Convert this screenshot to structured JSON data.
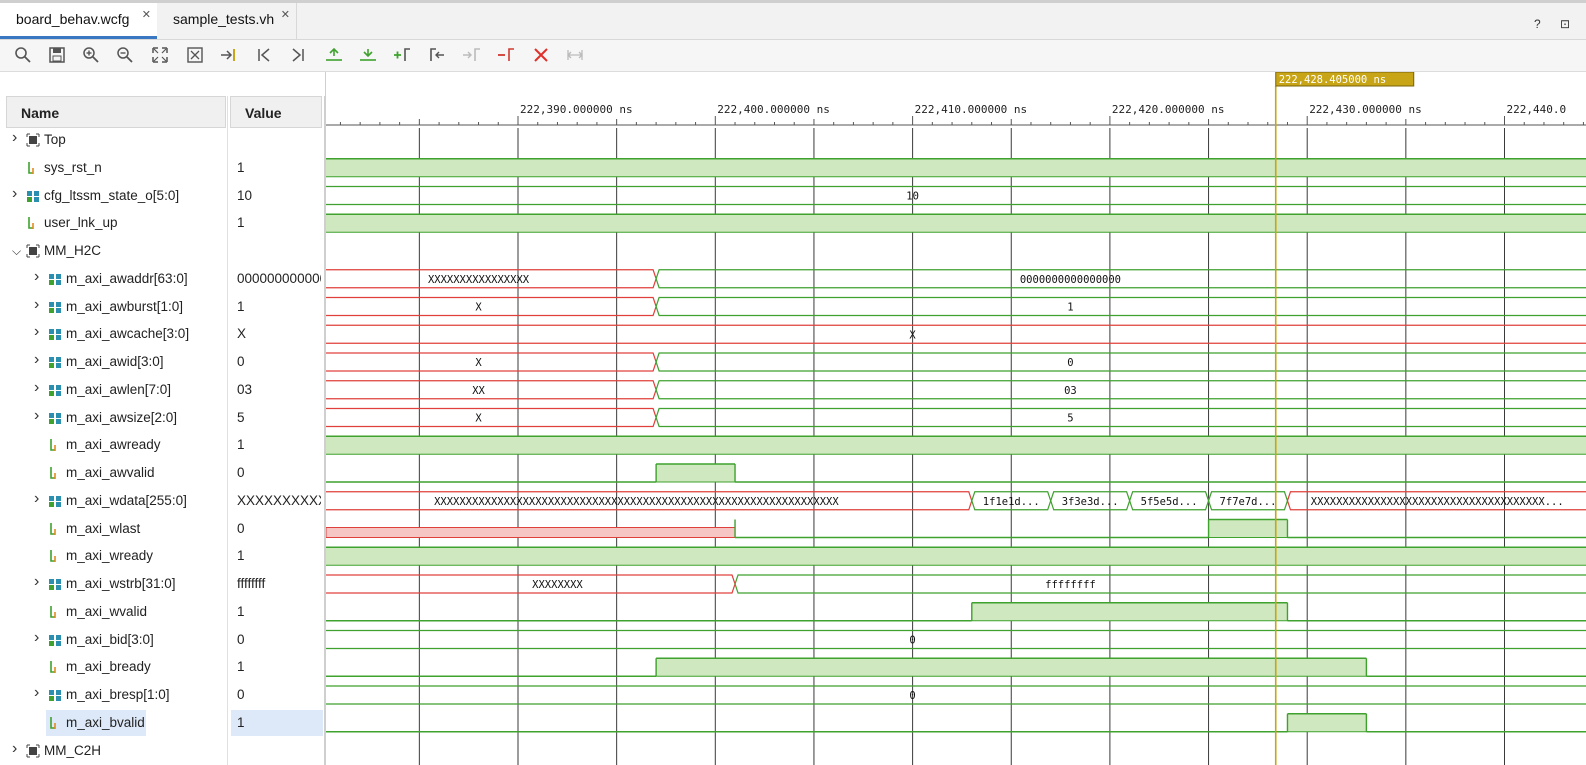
{
  "tabs": [
    {
      "label": "board_behav.wcfg",
      "active": true
    },
    {
      "label": "sample_tests.vh",
      "active": false
    }
  ],
  "window_icons": "? ⊡",
  "toolbar": [
    "search-icon",
    "save-icon",
    "zoom-in-icon",
    "zoom-out-icon",
    "zoom-fit-icon",
    "zoom-full-icon",
    "go-to-cursor-icon",
    "go-to-time-zero-icon",
    "go-to-last-time-icon",
    "previous-transition-icon",
    "next-transition-icon",
    "add-marker-icon",
    "previous-marker-icon",
    "next-marker-icon",
    "swap-cursors-icon",
    "delete-marker-icon",
    "snap-to-transition-icon"
  ],
  "columns": {
    "name": "Name",
    "value": "Value"
  },
  "cursor": {
    "label": "222,428.405000 ns",
    "time": 222428.405
  },
  "timeline": {
    "start": 222381.0,
    "end": 222444.0,
    "major": 10,
    "ticks": [
      {
        "t": 222390,
        "label": "222,390.000000 ns"
      },
      {
        "t": 222400,
        "label": "222,400.000000 ns"
      },
      {
        "t": 222410,
        "label": "222,410.000000 ns"
      },
      {
        "t": 222420,
        "label": "222,420.000000 ns"
      },
      {
        "t": 222430,
        "label": "222,430.000000 ns"
      },
      {
        "t": 222440,
        "label": "222,440.0"
      }
    ]
  },
  "colors": {
    "signal": "#3fa12e",
    "high_fill": "#cfe8bf",
    "undefined": "#e0403c",
    "undefined_fill": "#f6c6c4",
    "cursor": "#c8a516",
    "grid": "#3a3a3a"
  },
  "signals": [
    {
      "name": "Top",
      "value": "",
      "depth": 0,
      "kind": "group",
      "expanded": false,
      "wave": {
        "type": "none"
      }
    },
    {
      "name": "sys_rst_n",
      "value": "1",
      "depth": 0,
      "kind": "bit",
      "wave": {
        "type": "bit",
        "segs": [
          {
            "t": null,
            "v": "1"
          }
        ]
      }
    },
    {
      "name": "cfg_ltssm_state_o[5:0]",
      "value": "10",
      "depth": 0,
      "kind": "bus",
      "expanded": false,
      "wave": {
        "type": "bus",
        "segs": [
          {
            "t": null,
            "v": "10",
            "label": "10",
            "labelAt": 222410
          }
        ]
      }
    },
    {
      "name": "user_lnk_up",
      "value": "1",
      "depth": 0,
      "kind": "bit",
      "wave": {
        "type": "bit",
        "segs": [
          {
            "t": null,
            "v": "1"
          }
        ]
      }
    },
    {
      "name": "MM_H2C",
      "value": "",
      "depth": 0,
      "kind": "group",
      "expanded": true,
      "wave": {
        "type": "none"
      }
    },
    {
      "name": "m_axi_awaddr[63:0]",
      "value": "000000000000",
      "depth": 1,
      "kind": "bus",
      "expanded": false,
      "wave": {
        "type": "bus",
        "segs": [
          {
            "t": null,
            "v": "X",
            "label": "XXXXXXXXXXXXXXXX",
            "labelAt": 222388
          },
          {
            "t": 222397,
            "v": "0",
            "label": "0000000000000000",
            "labelAt": 222418
          }
        ]
      }
    },
    {
      "name": "m_axi_awburst[1:0]",
      "value": "1",
      "depth": 1,
      "kind": "bus",
      "expanded": false,
      "wave": {
        "type": "bus",
        "segs": [
          {
            "t": null,
            "v": "X",
            "label": "X",
            "labelAt": 222388
          },
          {
            "t": 222397,
            "v": "1",
            "label": "1",
            "labelAt": 222418
          }
        ]
      }
    },
    {
      "name": "m_axi_awcache[3:0]",
      "value": "X",
      "depth": 1,
      "kind": "bus",
      "expanded": false,
      "wave": {
        "type": "bus",
        "segs": [
          {
            "t": null,
            "v": "X",
            "label": "X",
            "labelAt": 222410
          }
        ]
      }
    },
    {
      "name": "m_axi_awid[3:0]",
      "value": "0",
      "depth": 1,
      "kind": "bus",
      "expanded": false,
      "wave": {
        "type": "bus",
        "segs": [
          {
            "t": null,
            "v": "X",
            "label": "X",
            "labelAt": 222388
          },
          {
            "t": 222397,
            "v": "0",
            "label": "0",
            "labelAt": 222418
          }
        ]
      }
    },
    {
      "name": "m_axi_awlen[7:0]",
      "value": "03",
      "depth": 1,
      "kind": "bus",
      "expanded": false,
      "wave": {
        "type": "bus",
        "segs": [
          {
            "t": null,
            "v": "X",
            "label": "XX",
            "labelAt": 222388
          },
          {
            "t": 222397,
            "v": "03",
            "label": "03",
            "labelAt": 222418
          }
        ]
      }
    },
    {
      "name": "m_axi_awsize[2:0]",
      "value": "5",
      "depth": 1,
      "kind": "bus",
      "expanded": false,
      "wave": {
        "type": "bus",
        "segs": [
          {
            "t": null,
            "v": "X",
            "label": "X",
            "labelAt": 222388
          },
          {
            "t": 222397,
            "v": "5",
            "label": "5",
            "labelAt": 222418
          }
        ]
      }
    },
    {
      "name": "m_axi_awready",
      "value": "1",
      "depth": 1,
      "kind": "bit",
      "wave": {
        "type": "bit",
        "segs": [
          {
            "t": null,
            "v": "1"
          }
        ]
      }
    },
    {
      "name": "m_axi_awvalid",
      "value": "0",
      "depth": 1,
      "kind": "bit",
      "wave": {
        "type": "bit",
        "segs": [
          {
            "t": null,
            "v": "0"
          },
          {
            "t": 222397,
            "v": "1"
          },
          {
            "t": 222401,
            "v": "0"
          }
        ]
      }
    },
    {
      "name": "m_axi_wdata[255:0]",
      "value": "XXXXXXXXXXX",
      "depth": 1,
      "kind": "bus",
      "expanded": false,
      "wave": {
        "type": "bus",
        "segs": [
          {
            "t": null,
            "v": "X",
            "label": "XXXXXXXXXXXXXXXXXXXXXXXXXXXXXXXXXXXXXXXXXXXXXXXXXXXXXXXXXXXXXXXX",
            "labelAt": 222396
          },
          {
            "t": 222413,
            "v": "d1",
            "label": "1f1e1d..."
          },
          {
            "t": 222417,
            "v": "d2",
            "label": "3f3e3d..."
          },
          {
            "t": 222421,
            "v": "d3",
            "label": "5f5e5d..."
          },
          {
            "t": 222425,
            "v": "d4",
            "label": "7f7e7d..."
          },
          {
            "t": 222429,
            "v": "X",
            "label": "XXXXXXXXXXXXXXXXXXXXXXXXXXXXXXXXXXXXX..."
          }
        ]
      }
    },
    {
      "name": "m_axi_wlast",
      "value": "0",
      "depth": 1,
      "kind": "bit",
      "wave": {
        "type": "bit",
        "segs": [
          {
            "t": null,
            "v": "X"
          },
          {
            "t": 222401,
            "v": "0"
          },
          {
            "t": 222425,
            "v": "1"
          },
          {
            "t": 222429,
            "v": "0"
          }
        ]
      }
    },
    {
      "name": "m_axi_wready",
      "value": "1",
      "depth": 1,
      "kind": "bit",
      "wave": {
        "type": "bit",
        "segs": [
          {
            "t": null,
            "v": "1"
          }
        ]
      }
    },
    {
      "name": "m_axi_wstrb[31:0]",
      "value": "ffffffff",
      "depth": 1,
      "kind": "bus",
      "expanded": false,
      "wave": {
        "type": "bus",
        "segs": [
          {
            "t": null,
            "v": "X",
            "label": "XXXXXXXX",
            "labelAt": 222392
          },
          {
            "t": 222401,
            "v": "f",
            "label": "ffffffff",
            "labelAt": 222418
          }
        ]
      }
    },
    {
      "name": "m_axi_wvalid",
      "value": "1",
      "depth": 1,
      "kind": "bit",
      "wave": {
        "type": "bit",
        "segs": [
          {
            "t": null,
            "v": "0"
          },
          {
            "t": 222413,
            "v": "1"
          },
          {
            "t": 222429,
            "v": "0"
          }
        ]
      }
    },
    {
      "name": "m_axi_bid[3:0]",
      "value": "0",
      "depth": 1,
      "kind": "bus",
      "expanded": false,
      "wave": {
        "type": "bus",
        "segs": [
          {
            "t": null,
            "v": "0",
            "label": "0",
            "labelAt": 222410
          }
        ]
      }
    },
    {
      "name": "m_axi_bready",
      "value": "1",
      "depth": 1,
      "kind": "bit",
      "wave": {
        "type": "bit",
        "segs": [
          {
            "t": null,
            "v": "0"
          },
          {
            "t": 222397,
            "v": "1"
          },
          {
            "t": 222433,
            "v": "0"
          }
        ]
      }
    },
    {
      "name": "m_axi_bresp[1:0]",
      "value": "0",
      "depth": 1,
      "kind": "bus",
      "expanded": false,
      "wave": {
        "type": "bus",
        "segs": [
          {
            "t": null,
            "v": "0",
            "label": "0",
            "labelAt": 222410
          }
        ]
      }
    },
    {
      "name": "m_axi_bvalid",
      "value": "1",
      "depth": 1,
      "kind": "bit",
      "selected": true,
      "wave": {
        "type": "bit",
        "segs": [
          {
            "t": null,
            "v": "0"
          },
          {
            "t": 222429,
            "v": "1"
          },
          {
            "t": 222433,
            "v": "0"
          }
        ]
      }
    },
    {
      "name": "MM_C2H",
      "value": "",
      "depth": 0,
      "kind": "group",
      "expanded": false,
      "wave": {
        "type": "none"
      }
    }
  ]
}
